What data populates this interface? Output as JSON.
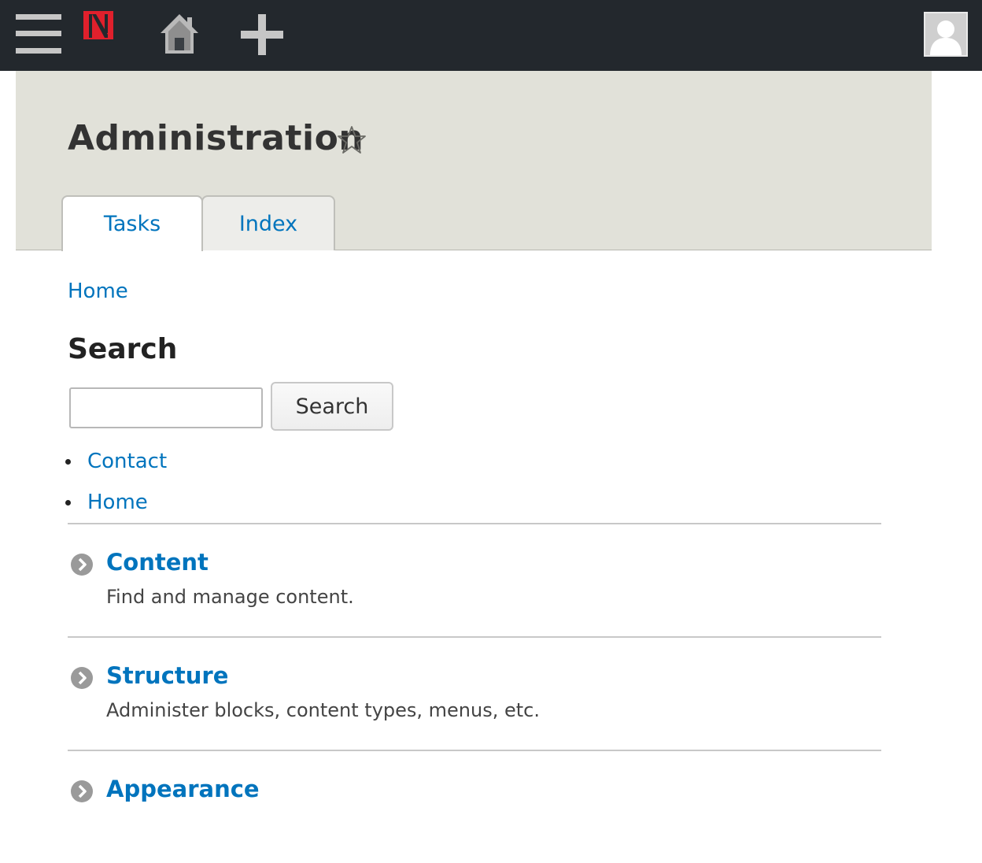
{
  "toolbar": {
    "icons": [
      "hamburger-menu-icon",
      "site-logo-icon",
      "home-icon",
      "add-icon",
      "user-avatar-icon"
    ],
    "colors": {
      "background": "#23282d",
      "logo_red": "#e0202c",
      "icon_gray": "#c6c6c6"
    }
  },
  "header": {
    "title": "Administration",
    "tabs": [
      {
        "label": "Tasks",
        "active": true
      },
      {
        "label": "Index",
        "active": false
      }
    ]
  },
  "breadcrumb": {
    "home": "Home"
  },
  "search": {
    "heading": "Search",
    "input_value": "",
    "button_label": "Search"
  },
  "links": [
    {
      "label": "Contact"
    },
    {
      "label": "Home"
    }
  ],
  "admin_items": [
    {
      "title": "Content",
      "description": "Find and manage content."
    },
    {
      "title": "Structure",
      "description": "Administer blocks, content types, menus, etc."
    },
    {
      "title": "Appearance",
      "description": ""
    }
  ],
  "colors": {
    "link": "#0074bd",
    "header_bg": "#e1e1d9"
  }
}
